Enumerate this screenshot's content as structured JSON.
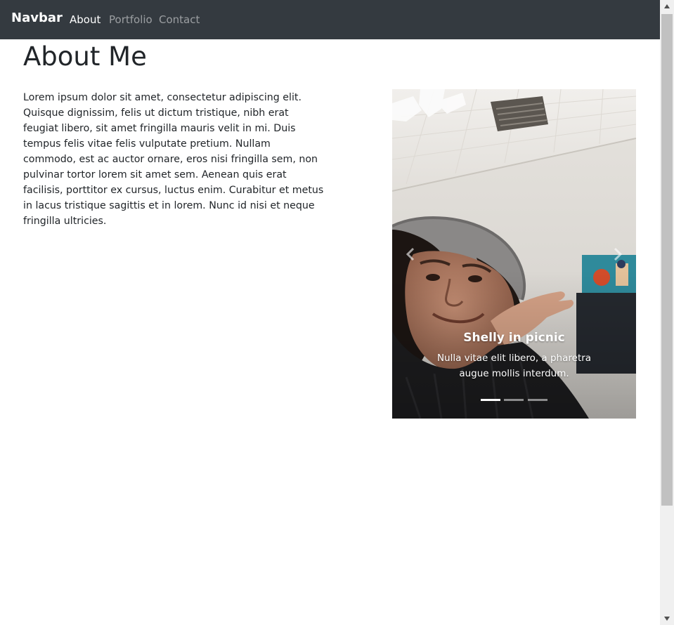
{
  "navbar": {
    "brand": "Navbar",
    "links": [
      {
        "label": "About",
        "active": true
      },
      {
        "label": "Portfolio",
        "active": false
      },
      {
        "label": "Contact",
        "active": false
      }
    ]
  },
  "main": {
    "title": "About Me",
    "paragraph": "Lorem ipsum dolor sit amet, consectetur adipiscing elit. Quisque dignissim, felis ut dictum tristique, nibh erat feugiat libero, sit amet fringilla mauris velit in mi. Duis tempus felis vitae felis vulputate pretium. Nullam commodo, est ac auctor ornare, eros nisi fringilla sem, non pulvinar tortor lorem sit amet sem. Aenean quis erat facilisis, porttitor ex cursus, luctus enim. Curabitur et metus in lacus tristique sagittis et in lorem. Nunc id nisi et neque fringilla ultricies."
  },
  "carousel": {
    "image": "selfie-photo",
    "caption_title": "Shelly in picnic",
    "caption_text": "Nulla vitae elit libero, a pharetra augue mollis interdum.",
    "slide_count": 3,
    "active_slide": 1,
    "prev_icon": "chevron-left-icon",
    "next_icon": "chevron-right-icon"
  },
  "colors": {
    "navbar_bg": "#343a40",
    "text": "#212529"
  }
}
